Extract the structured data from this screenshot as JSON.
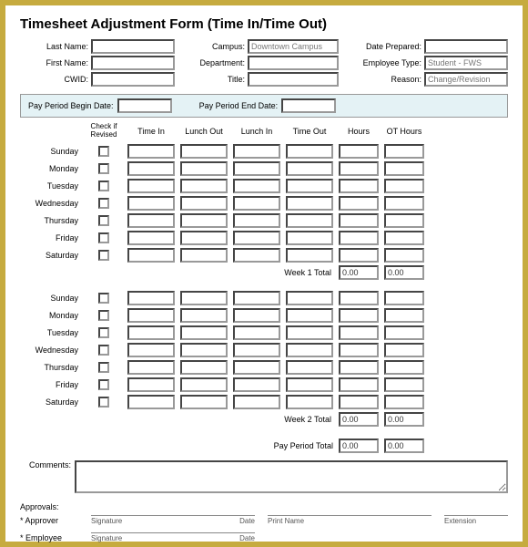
{
  "title": "Timesheet Adjustment Form (Time In/Time Out)",
  "header": {
    "last_name": {
      "label": "Last Name:",
      "value": ""
    },
    "first_name": {
      "label": "First Name:",
      "value": ""
    },
    "cwid": {
      "label": "CWID:",
      "value": ""
    },
    "campus": {
      "label": "Campus:",
      "value": "Downtown Campus"
    },
    "department": {
      "label": "Department:",
      "value": ""
    },
    "title_f": {
      "label": "Title:",
      "value": ""
    },
    "date_prepared": {
      "label": "Date Prepared:",
      "value": ""
    },
    "employee_type": {
      "label": "Employee Type:",
      "value": "Student - FWS"
    },
    "reason": {
      "label": "Reason:",
      "value": "Change/Revision"
    }
  },
  "pay_period": {
    "begin": {
      "label": "Pay Period Begin Date:",
      "value": ""
    },
    "end": {
      "label": "Pay Period End Date:",
      "value": ""
    }
  },
  "columns": {
    "check": "Check if Revised",
    "time_in": "Time In",
    "lunch_out": "Lunch Out",
    "lunch_in": "Lunch In",
    "time_out": "Time Out",
    "hours": "Hours",
    "ot": "OT Hours"
  },
  "days": [
    "Sunday",
    "Monday",
    "Tuesday",
    "Wednesday",
    "Thursday",
    "Friday",
    "Saturday"
  ],
  "totals": {
    "week1": {
      "label": "Week 1 Total",
      "hours": "0.00",
      "ot": "0.00"
    },
    "week2": {
      "label": "Week 2 Total",
      "hours": "0.00",
      "ot": "0.00"
    },
    "period": {
      "label": "Pay Period Total",
      "hours": "0.00",
      "ot": "0.00"
    }
  },
  "comments": {
    "label": "Comments:",
    "value": ""
  },
  "approvals": {
    "heading": "Approvals:",
    "approver": "* Approver",
    "employee": "* Employee",
    "signature": "Signature",
    "date": "Date",
    "print_name": "Print Name",
    "extension": "Extension"
  }
}
